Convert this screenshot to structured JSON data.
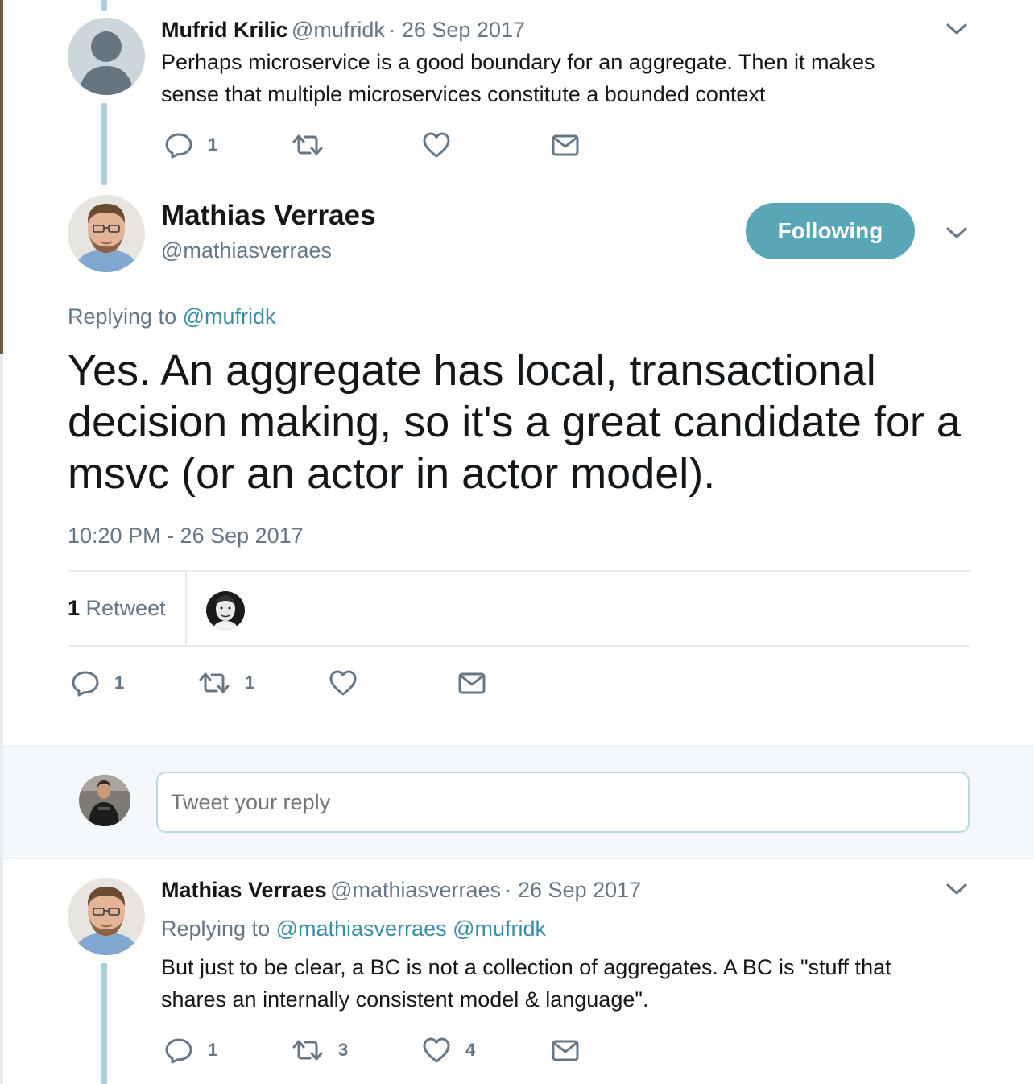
{
  "parent_tweet": {
    "author_name": "Mufrid Krilic",
    "author_handle": "@mufridk",
    "date": "· 26 Sep 2017",
    "text_line1": "Perhaps microservice is a good boundary for an aggregate. Then it makes",
    "text_line2": "sense that multiple microservices constitute a bounded context",
    "reply_count": "1",
    "retweet_count": "",
    "like_count": ""
  },
  "main_tweet": {
    "author_name": "Mathias Verraes",
    "author_handle": "@mathiasverraes",
    "follow_label": "Following",
    "replying_prefix": "Replying to",
    "replying_to": "@mufridk",
    "text": "Yes. An aggregate has local, transactional decision making, so it's a great candidate for a msvc (or an actor in actor model).",
    "timestamp": "10:20 PM - 26 Sep 2017",
    "retweets_number": "1",
    "retweets_label": "Retweet",
    "reply_count": "1",
    "retweet_count": "1",
    "like_count": ""
  },
  "reply_box": {
    "placeholder": "Tweet your reply"
  },
  "child_tweet": {
    "author_name": "Mathias Verraes",
    "author_handle": "@mathiasverraes",
    "date": "· 26 Sep 2017",
    "replying_prefix": "Replying to",
    "replying_to": "@mathiasverraes @mufridk",
    "text_line1": "But just to be clear, a BC is not a collection of aggregates. A BC is \"stuff that",
    "text_line2": "shares an internally consistent model & language\".",
    "reply_count": "1",
    "retweet_count": "3",
    "like_count": "4"
  },
  "colors": {
    "accent": "#58a6b6",
    "link": "#3a8fa6",
    "thread_line": "#a8d2db",
    "secondary_text": "#657786"
  },
  "icons": [
    "reply-icon",
    "retweet-icon",
    "like-icon",
    "message-icon",
    "chevron-down-icon"
  ]
}
